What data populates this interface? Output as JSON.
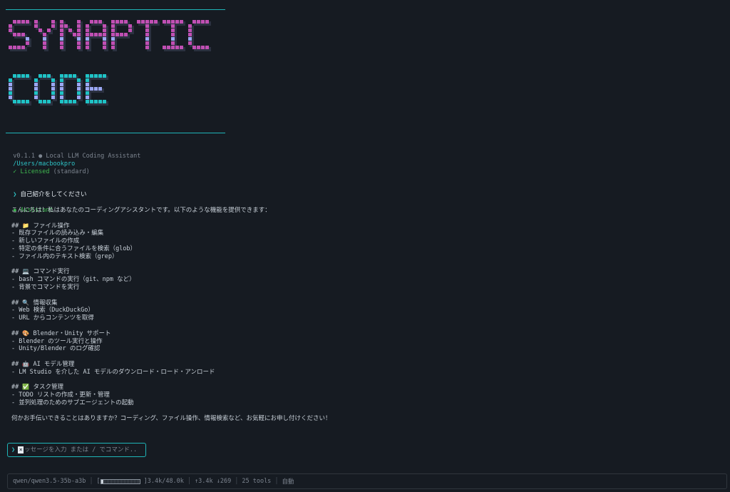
{
  "logo": {
    "line1": "SYNAPTIC",
    "line2": "CODE",
    "colors": {
      "line1": "#c04fb3",
      "line2": "#1fc3c6",
      "accent": "#9aa6f2"
    }
  },
  "meta": {
    "version": "v0.1.1",
    "dot": "●",
    "subtitle": "Local LLM Coding Assistant",
    "path": "/Users/macbookpro",
    "license_check": "✓",
    "license": "Licensed",
    "license_tier": "(standard)"
  },
  "conversation": {
    "user_prompt_arrow": "❯",
    "user_message": "自己紹介をしてください",
    "assistant_marker": "◆",
    "assistant_label": "Assistant",
    "intro": "こんにちは！私はあなたのコーディングアシスタントです。以下のような機能を提供できます：",
    "sections": [
      {
        "heading_prefix": "##",
        "icon": "📁",
        "title": "ファイル操作",
        "items": [
          "- 既存ファイルの読み込み・編集",
          "- 新しいファイルの作成",
          "- 特定の条件に合うファイルを検索（glob）",
          "- ファイル内のテキスト検索（grep）"
        ]
      },
      {
        "heading_prefix": "##",
        "icon": "💻",
        "title": "コマンド実行",
        "items": [
          "- bash コマンドの実行（git、npm など）",
          "- 背景でコマンドを実行"
        ]
      },
      {
        "heading_prefix": "##",
        "icon": "🔍",
        "title": "情報収集",
        "items": [
          "- Web 検索（DuckDuckGo）",
          "- URL からコンテンツを取得"
        ]
      },
      {
        "heading_prefix": "##",
        "icon": "🎨",
        "title": "Blender・Unity サポート",
        "items": [
          "- Blender のツール実行と操作",
          "- Unity/Blender のログ確認"
        ]
      },
      {
        "heading_prefix": "##",
        "icon": "🤖",
        "title": "AI モデル管理",
        "items": [
          "- LM Studio を介した AI モデルのダウンロード・ロード・アンロード"
        ]
      },
      {
        "heading_prefix": "##",
        "icon": "✅",
        "title": "タスク管理",
        "items": [
          "- TODO リストの作成・更新・管理",
          "- 並列処理のためのサブエージェントの起動"
        ]
      }
    ],
    "closing": "何かお手伝いできることはありますか？コーディング、ファイル操作、情報検索など、お気軽にお申し付けください！"
  },
  "input": {
    "arrow": "❯",
    "cursor_glyph": "×",
    "placeholder": "ッセージを入力 または / でコマンド..."
  },
  "status": {
    "model": "qwen/qwen3.5-35b-a3b",
    "context_bracket_open": "[",
    "context_bracket_close": "]",
    "context_fill": 0.07,
    "context": "3.4k/48.0k",
    "tokens": "↑3.4k ↓269",
    "tools": "25 tools",
    "mode": "自動"
  },
  "colors": {
    "background": "#161b22",
    "accent_cyan": "#1fb5b8",
    "accent_green": "#3fb950",
    "text": "#c9d1d9",
    "muted": "#7d8590"
  }
}
